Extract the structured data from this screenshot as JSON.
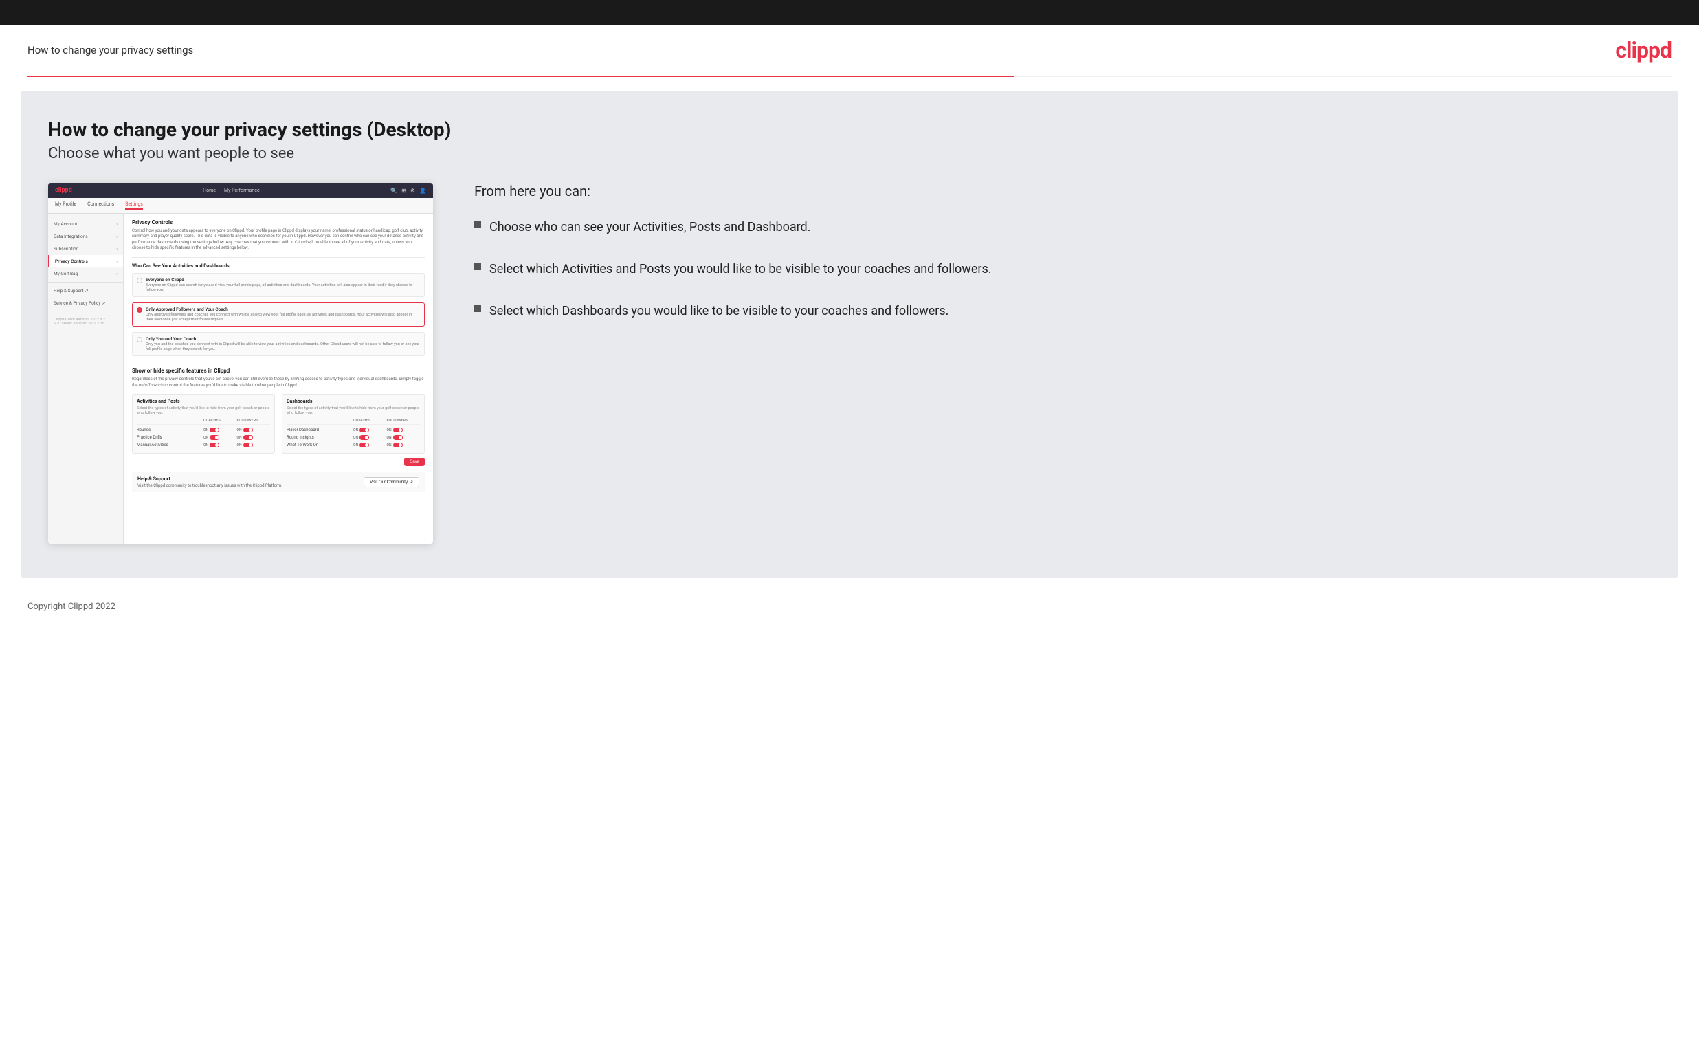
{
  "topBar": {},
  "header": {
    "title": "How to change your privacy settings",
    "logo": "clippd"
  },
  "main": {
    "heading": "How to change your privacy settings (Desktop)",
    "subheading": "Choose what you want people to see",
    "rightPanel": {
      "fromHere": "From here you can:",
      "bullets": [
        "Choose who can see your Activities, Posts and Dashboard.",
        "Select which Activities and Posts you would like to be visible to your coaches and followers.",
        "Select which Dashboards you would like to be visible to your coaches and followers."
      ]
    }
  },
  "appMockup": {
    "nav": {
      "logo": "clippd",
      "links": [
        "Home",
        "My Performance"
      ],
      "icons": [
        "🔍",
        "⊞",
        "⚙",
        "👤"
      ]
    },
    "subnav": [
      "My Profile",
      "Connections",
      "Settings"
    ],
    "activeSubnav": "Settings",
    "sidebar": {
      "items": [
        {
          "label": "My Account",
          "hasArrow": true,
          "active": false
        },
        {
          "label": "Data Integrations",
          "hasArrow": true,
          "active": false
        },
        {
          "label": "Subscription",
          "hasArrow": true,
          "active": false
        },
        {
          "label": "Privacy Controls",
          "hasArrow": true,
          "active": true
        },
        {
          "label": "My Golf Bag",
          "hasArrow": true,
          "active": false
        },
        {
          "label": "Help & Support ↗",
          "hasArrow": false,
          "active": false
        },
        {
          "label": "Service & Privacy Policy ↗",
          "hasArrow": false,
          "active": false
        }
      ],
      "footer": [
        "Clippd Client Version: 2022.8.2",
        "SQL Server Version: 2022.7.38"
      ]
    },
    "mainPanel": {
      "sectionTitle": "Privacy Controls",
      "sectionDesc": "Control how you and your data appears to everyone on Clippd. Your profile page in Clippd displays your name, professional status or handicap, golf club, activity summary and player quality score. This data is visible to anyone who searches for you in Clippd. However you can control who can see your detailed activity and performance dashboards using the settings below. Any coaches that you connect with in Clippd will be able to see all of your activity and data, unless you choose to hide specific features in the advanced settings below.",
      "whoTitle": "Who Can See Your Activities and Dashboards",
      "radioOptions": [
        {
          "id": "everyone",
          "label": "Everyone on Clippd",
          "desc": "Everyone on Clippd can search for you and view your full profile page, all activities and dashboards. Your activities will also appear in their feed if they choose to follow you.",
          "selected": false
        },
        {
          "id": "followers",
          "label": "Only Approved Followers and Your Coach",
          "desc": "Only approved followers and coaches you connect with will be able to view your full profile page, all activities and dashboards. Your activities will also appear in their feed once you accept their follow request.",
          "selected": true
        },
        {
          "id": "coach",
          "label": "Only You and Your Coach",
          "desc": "Only you and the coaches you connect with in Clippd will be able to view your activities and dashboards. Other Clippd users will not be able to follow you or see your full profile page when they search for you.",
          "selected": false
        }
      ],
      "showHideTitle": "Show or hide specific features in Clippd",
      "showHideDesc": "Regardless of the privacy controls that you've set above, you can still override these by limiting access to activity types and individual dashboards. Simply toggle the on/off switch to control the features you'd like to make visible to other people in Clippd.",
      "activitiesTable": {
        "title": "Activities and Posts",
        "desc": "Select the types of activity that you'd like to hide from your golf coach or people who follow you.",
        "headers": [
          "",
          "COACHES",
          "FOLLOWERS"
        ],
        "rows": [
          {
            "label": "Rounds",
            "coachOn": true,
            "followerOn": true
          },
          {
            "label": "Practice Drills",
            "coachOn": true,
            "followerOn": true
          },
          {
            "label": "Manual Activities",
            "coachOn": true,
            "followerOn": true
          }
        ]
      },
      "dashboardsTable": {
        "title": "Dashboards",
        "desc": "Select the types of activity that you'd like to hide from your golf coach or people who follow you.",
        "headers": [
          "",
          "COACHES",
          "FOLLOWERS"
        ],
        "rows": [
          {
            "label": "Player Dashboard",
            "coachOn": true,
            "followerOn": true
          },
          {
            "label": "Round Insights",
            "coachOn": true,
            "followerOn": true
          },
          {
            "label": "What To Work On",
            "coachOn": true,
            "followerOn": true
          }
        ]
      },
      "saveBtn": "Save",
      "helpSection": {
        "title": "Help & Support",
        "desc": "Visit the Clippd community to troubleshoot any issues with the Clippd Platform.",
        "btnLabel": "Visit Our Community",
        "btnIcon": "↗"
      }
    }
  },
  "footer": {
    "copyright": "Copyright Clippd 2022"
  }
}
